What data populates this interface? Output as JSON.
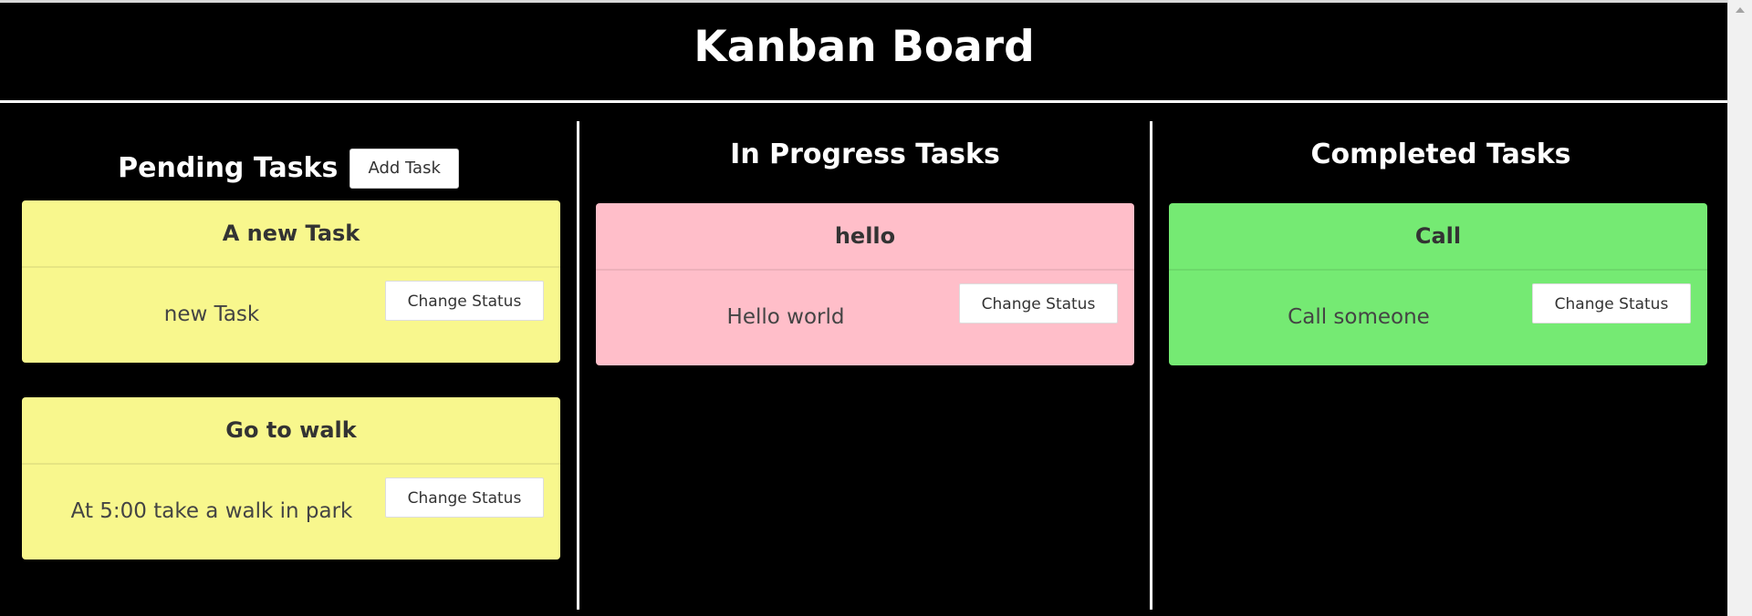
{
  "header": {
    "title": "Kanban Board"
  },
  "columns": {
    "pending": {
      "title": "Pending Tasks",
      "add_label": "Add Task",
      "cards": [
        {
          "title": "A new Task",
          "body": "new Task",
          "status_label": "Change Status"
        },
        {
          "title": "Go to walk",
          "body": "At 5:00 take a walk in park",
          "status_label": "Change Status"
        }
      ]
    },
    "progress": {
      "title": "In Progress Tasks",
      "cards": [
        {
          "title": "hello",
          "body": "Hello world",
          "status_label": "Change Status"
        }
      ]
    },
    "completed": {
      "title": "Completed Tasks",
      "cards": [
        {
          "title": "Call",
          "body": "Call someone",
          "status_label": "Change Status"
        }
      ]
    }
  },
  "colors": {
    "pending": "#f8f78d",
    "progress": "#ffbec9",
    "completed": "#75ea73",
    "background": "#000000"
  }
}
